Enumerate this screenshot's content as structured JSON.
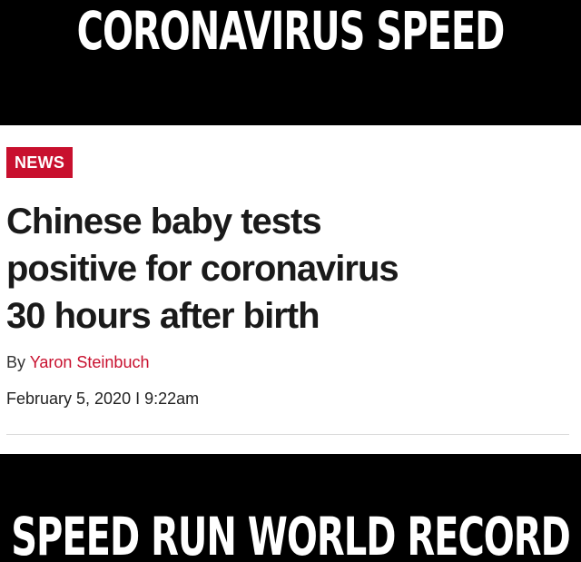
{
  "meme": {
    "top_caption": "CORONAVIRUS SPEED",
    "bottom_caption": "SPEED RUN WORLD RECORD"
  },
  "article": {
    "tag": "NEWS",
    "headline_lines": [
      "Chinese baby tests",
      "positive for coronavirus",
      "30 hours after birth"
    ],
    "byline_prefix": "By",
    "author": "Yaron Steinbuch",
    "date": "February 5, 2020",
    "separator": "I",
    "time": "9:22am"
  },
  "colors": {
    "tag_background": "#c8102e",
    "author_link": "#c8102e",
    "background": "#000000",
    "card": "#ffffff"
  }
}
